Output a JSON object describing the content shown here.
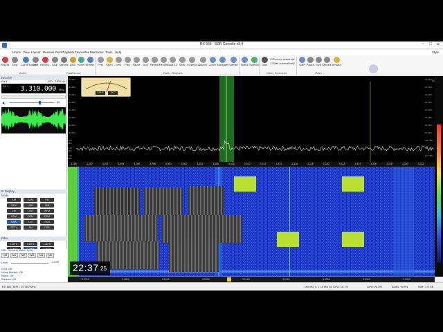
{
  "window": {
    "title": "RX 666 - SDR Console v3.4",
    "right_label": "Style"
  },
  "menu": [
    "Home",
    "View",
    "Layout",
    "Receive",
    "Rec/Playback",
    "Favourites",
    "Memories",
    "Tools",
    "Help"
  ],
  "ribbon": {
    "buttons": [
      {
        "label": "Record",
        "icon": "record-icon"
      },
      {
        "label": "Stop",
        "icon": "stop-icon"
      },
      {
        "label": "Cache Browse",
        "icon": "cache-icon"
      },
      {
        "label": "Stop",
        "icon": "stop-icon"
      },
      {
        "label": "Record...",
        "icon": "record-icon"
      },
      {
        "label": "Stop",
        "icon": "stop-icon"
      },
      {
        "label": "Options",
        "icon": "options-icon"
      },
      {
        "label": "Lock",
        "icon": "lock-icon"
      },
      {
        "label": "Radio",
        "icon": "radio-icon"
      },
      {
        "label": "Power",
        "icon": "power-icon"
      },
      {
        "label": "Browse",
        "icon": "browse-icon"
      },
      {
        "label": "First",
        "icon": "first-icon"
      },
      {
        "label": "Open",
        "icon": "open-icon"
      },
      {
        "label": "Next",
        "icon": "next-icon"
      },
      {
        "label": "Play",
        "icon": "play-icon"
      },
      {
        "label": "Pause",
        "icon": "pause-icon"
      },
      {
        "label": "Stop",
        "icon": "stop-icon"
      },
      {
        "label": "Repeat",
        "icon": "repeat-icon"
      },
      {
        "label": "Restart",
        "icon": "restart-icon"
      },
      {
        "label": "Back 10",
        "icon": "back-icon"
      },
      {
        "label": "Seek",
        "icon": "seek-icon"
      },
      {
        "label": "Forward 10",
        "icon": "forward-icon"
      },
      {
        "label": "Launch",
        "icon": "launch-icon"
      },
      {
        "label": "Zoom",
        "icon": "zoom-icon"
      },
      {
        "label": "Navigate",
        "icon": "navigate-icon"
      },
      {
        "label": "Satellite",
        "icon": "satellite-icon"
      },
      {
        "label": "Editor",
        "icon": "editor-icon"
      },
      {
        "label": "Status",
        "icon": "status-icon"
      },
      {
        "label": "Schedule",
        "icon": "schedule-icon"
      },
      {
        "label": "Start",
        "icon": "start-icon"
      },
      {
        "label": "Start",
        "icon": "start-icon"
      },
      {
        "label": "Pause",
        "icon": "pause-icon"
      },
      {
        "label": "Stop",
        "icon": "stop-icon"
      },
      {
        "label": "Options",
        "icon": "options-icon"
      },
      {
        "label": "Browse",
        "icon": "browse-icon"
      }
    ],
    "groups": [
      "Audio",
      "Data",
      "Record",
      "Data : Playback",
      "Data : Scheduler",
      "Video"
    ],
    "checkboxes": [
      "Show in status bar",
      "Start automatically"
    ]
  },
  "left_panel": {
    "receive_title": "Receive",
    "rx_label": "RX 1",
    "range": "200 - 2400 Hz",
    "frequency": "3.310.000",
    "freq_unit": "MHz",
    "audio_level": "86",
    "if_display_title": "IF Display",
    "mode_title": "Mode",
    "mode_buttons": [
      "AM",
      "SAM",
      "FM",
      "NFM",
      "USB",
      "LSB",
      "CW",
      "DSB",
      "WFM",
      "DRM",
      "DRM",
      "DRM",
      "USB",
      "CW",
      "SAM",
      "RTTY",
      "AM",
      "DSB"
    ],
    "filter_title": "Filter",
    "filter_buttons": [
      "1.0kHz",
      "1.5kHz",
      "1.8kHz",
      "2.0kHz",
      "2.2kHz",
      "2.5kHz",
      "2.7kHz",
      "3.0kHz",
      "3.5kHz",
      "4.0kHz",
      "5.0kHz",
      "6.0kHz"
    ],
    "audio_title": "Audio",
    "agc": "AGC: Medium",
    "csq": "CSQ: Off",
    "noise_blanker": "Noise Blanker: Off",
    "nr": "NR1: Spectral Match 1 (db)",
    "m_buttons": [
      "Off",
      "M1",
      "M2",
      "M3",
      "M4",
      "M5"
    ],
    "level_label": "Level",
    "level_value": "-11 dB",
    "notch": "Notch: Off",
    "squelch": "Squelch: Off"
  },
  "spectrum": {
    "db_labels": [
      "-20 dBm",
      "-30 dBm",
      "-40 dBm",
      "-50 dBm",
      "-60 dBm",
      "-70 dBm",
      "-80 dBm",
      "-90 dBm",
      "-100 dBm",
      "-110 dBm",
      "-120 dBm"
    ],
    "marker_label": "Chirp",
    "scale_ticks": [
      "3.288",
      "3.290",
      "3.292",
      "3.294",
      "3.296",
      "3.298",
      "3.300",
      "3.302",
      "3.304",
      "3.306",
      "3.308",
      "3.310",
      "3.312",
      "3.314",
      "3.316",
      "3.318",
      "3.320",
      "3.322",
      "3.324",
      "3.326",
      "3.328",
      "3.330",
      "3.332"
    ],
    "bottom_ticks": [
      "3.2700",
      "3.2800",
      "3.2900",
      "3.3000",
      "3.3100",
      "3.3200",
      "3.3300",
      "3.3400",
      "3.3500"
    ],
    "smeter_values": [
      "S9+ 6",
      "-66.7"
    ]
  },
  "clock": {
    "hm": "22:37",
    "sec": "25"
  },
  "status": {
    "left": "RX 666_8kH = 10.000 MHz",
    "mid": "-  000:00,  s: 17.8 MB (5)   CPU: 16.7%",
    "gpu": "GPU: 28.8%",
    "audio": "Audio: 96 ms",
    "size": "Size: 3.0 GB"
  }
}
